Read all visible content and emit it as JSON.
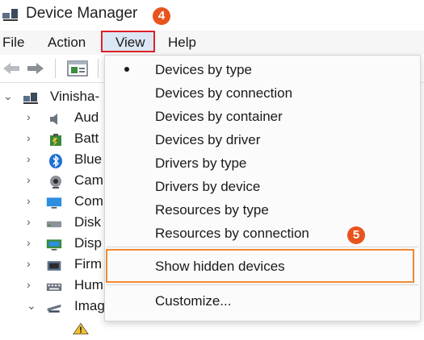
{
  "window": {
    "title": "Device Manager"
  },
  "callouts": {
    "step_view": "4",
    "step_hidden": "5"
  },
  "menubar": {
    "file": "File",
    "action": "Action",
    "view": "View",
    "help": "Help"
  },
  "tree": {
    "root": "Vinisha-",
    "items": [
      {
        "label": "Aud",
        "icon": "speaker-icon"
      },
      {
        "label": "Batt",
        "icon": "battery-icon"
      },
      {
        "label": "Blue",
        "icon": "bluetooth-icon"
      },
      {
        "label": "Cam",
        "icon": "camera-icon"
      },
      {
        "label": "Com",
        "icon": "monitor-icon"
      },
      {
        "label": "Disk",
        "icon": "disk-icon"
      },
      {
        "label": "Disp",
        "icon": "display-icon"
      },
      {
        "label": "Firm",
        "icon": "chip-icon"
      },
      {
        "label": "Hum",
        "icon": "keyboard-icon"
      },
      {
        "label": "Imag",
        "icon": "scanner-icon"
      }
    ]
  },
  "view_menu": {
    "items": [
      {
        "label": "Devices by type",
        "checked": true
      },
      {
        "label": "Devices by connection",
        "checked": false
      },
      {
        "label": "Devices by container",
        "checked": false
      },
      {
        "label": "Devices by driver",
        "checked": false
      },
      {
        "label": "Drivers by type",
        "checked": false
      },
      {
        "label": "Drivers by device",
        "checked": false
      },
      {
        "label": "Resources by type",
        "checked": false
      },
      {
        "label": "Resources by connection",
        "checked": false
      }
    ],
    "show_hidden": "Show hidden devices",
    "customize": "Customize..."
  },
  "colors": {
    "view_highlight": "#e0212a",
    "step_badge": "#e8541e",
    "hidden_highlight": "#ef8a34"
  }
}
